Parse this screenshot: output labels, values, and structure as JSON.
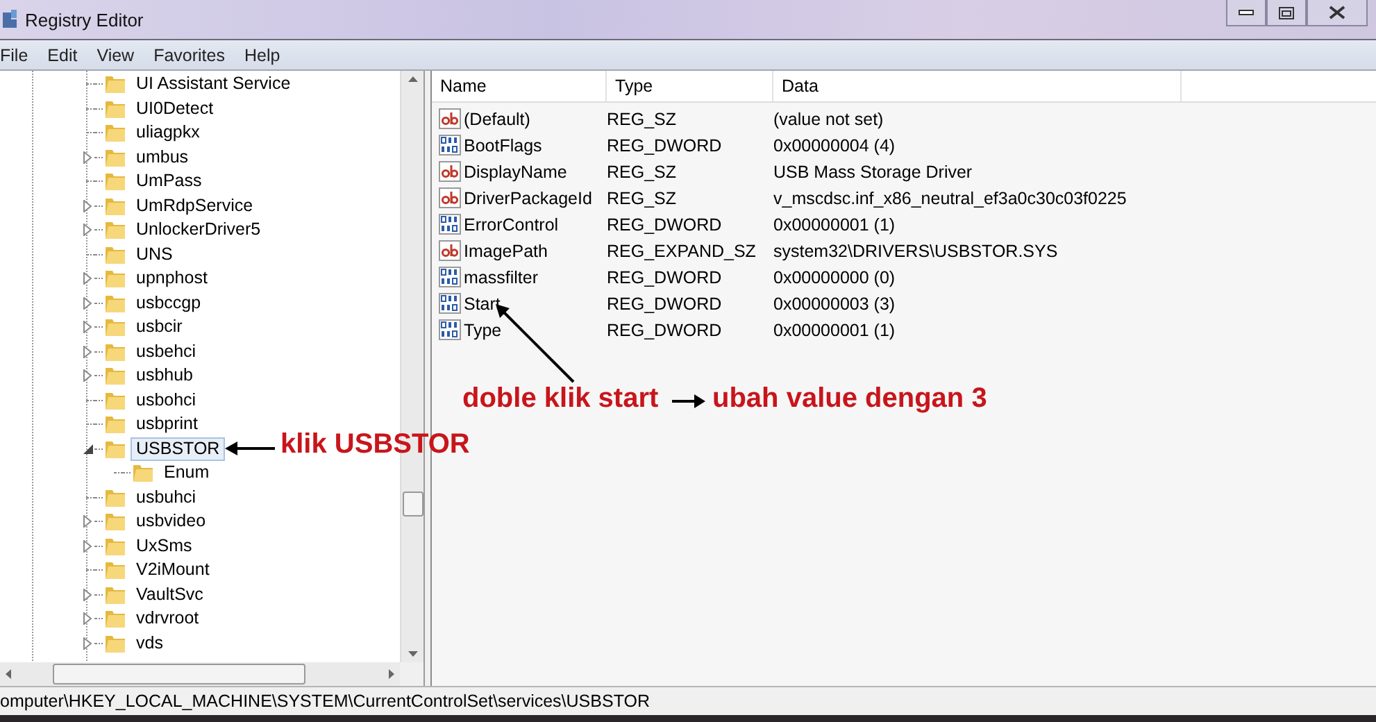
{
  "window": {
    "title": "Registry Editor"
  },
  "menu": [
    "File",
    "Edit",
    "View",
    "Favorites",
    "Help"
  ],
  "tree": {
    "items": [
      {
        "label": "UI Assistant Service",
        "kind": "leaf",
        "selected": false
      },
      {
        "label": "UI0Detect",
        "kind": "leaf",
        "selected": false
      },
      {
        "label": "uliagpkx",
        "kind": "leaf",
        "selected": false
      },
      {
        "label": "umbus",
        "kind": "collapsed",
        "selected": false
      },
      {
        "label": "UmPass",
        "kind": "leaf",
        "selected": false
      },
      {
        "label": "UmRdpService",
        "kind": "collapsed",
        "selected": false
      },
      {
        "label": "UnlockerDriver5",
        "kind": "collapsed",
        "selected": false
      },
      {
        "label": "UNS",
        "kind": "leaf",
        "selected": false
      },
      {
        "label": "upnphost",
        "kind": "collapsed",
        "selected": false
      },
      {
        "label": "usbccgp",
        "kind": "collapsed",
        "selected": false
      },
      {
        "label": "usbcir",
        "kind": "collapsed",
        "selected": false
      },
      {
        "label": "usbehci",
        "kind": "collapsed",
        "selected": false
      },
      {
        "label": "usbhub",
        "kind": "collapsed",
        "selected": false
      },
      {
        "label": "usbohci",
        "kind": "leaf",
        "selected": false
      },
      {
        "label": "usbprint",
        "kind": "leaf",
        "selected": false
      },
      {
        "label": "USBSTOR",
        "kind": "expanded",
        "selected": true,
        "children": [
          {
            "label": "Enum",
            "kind": "leaf",
            "selected": false
          }
        ]
      },
      {
        "label": "usbuhci",
        "kind": "leaf",
        "selected": false
      },
      {
        "label": "usbvideo",
        "kind": "collapsed",
        "selected": false
      },
      {
        "label": "UxSms",
        "kind": "collapsed",
        "selected": false
      },
      {
        "label": "V2iMount",
        "kind": "leaf",
        "selected": false
      },
      {
        "label": "VaultSvc",
        "kind": "collapsed",
        "selected": false
      },
      {
        "label": "vdrvroot",
        "kind": "collapsed",
        "selected": false
      },
      {
        "label": "vds",
        "kind": "collapsed",
        "selected": false
      }
    ]
  },
  "values": {
    "columns": [
      "Name",
      "Type",
      "Data"
    ],
    "rows": [
      {
        "kind": "string",
        "name": "(Default)",
        "type": "REG_SZ",
        "data": "(value not set)"
      },
      {
        "kind": "binary",
        "name": "BootFlags",
        "type": "REG_DWORD",
        "data": "0x00000004 (4)"
      },
      {
        "kind": "string",
        "name": "DisplayName",
        "type": "REG_SZ",
        "data": "USB Mass Storage Driver"
      },
      {
        "kind": "string",
        "name": "DriverPackageId",
        "type": "REG_SZ",
        "data": "v_mscdsc.inf_x86_neutral_ef3a0c30c03f0225"
      },
      {
        "kind": "binary",
        "name": "ErrorControl",
        "type": "REG_DWORD",
        "data": "0x00000001 (1)"
      },
      {
        "kind": "string",
        "name": "ImagePath",
        "type": "REG_EXPAND_SZ",
        "data": "system32\\DRIVERS\\USBSTOR.SYS"
      },
      {
        "kind": "binary",
        "name": "massfilter",
        "type": "REG_DWORD",
        "data": "0x00000000 (0)"
      },
      {
        "kind": "binary",
        "name": "Start",
        "type": "REG_DWORD",
        "data": "0x00000003 (3)"
      },
      {
        "kind": "binary",
        "name": "Type",
        "type": "REG_DWORD",
        "data": "0x00000001 (1)"
      }
    ]
  },
  "annotations": [
    "klik USBSTOR",
    "doble klik start",
    "ubah value dengan 3"
  ],
  "status_bar": "omputer\\HKEY_LOCAL_MACHINE\\SYSTEM\\CurrentControlSet\\services\\USBSTOR"
}
